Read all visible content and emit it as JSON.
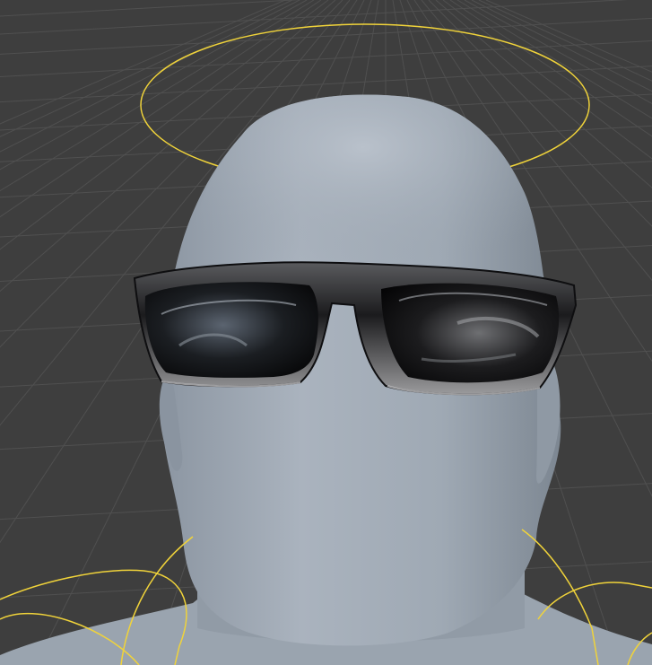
{
  "viewport": {
    "background": "#3e3e3e",
    "grid_color": "#4e4e4e",
    "selection_outline_color": "#f0d33a"
  },
  "scene": {
    "objects": [
      {
        "name": "head",
        "material": "clay-gray",
        "color": "#a7b0bb"
      },
      {
        "name": "sunglasses",
        "material": "chrome-black",
        "color": "#1a1a1c"
      }
    ],
    "icons": [
      "bone-rig-circle-top",
      "bone-rig-circle-left",
      "bone-rig-circle-right"
    ]
  }
}
